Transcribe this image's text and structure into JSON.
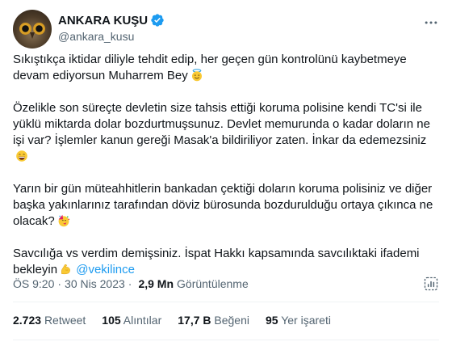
{
  "author": {
    "display_name": "ANKARA KUŞU",
    "handle": "@ankara_kusu",
    "verified": true,
    "avatar": "owl-avatar"
  },
  "tweet": {
    "p1_text": "Sıkıştıkça iktidar diliyle tehdit edip, her geçen gün kontrolünü kaybetmeye devam ediyorsun Muharrem Bey",
    "p1_emoji": "smiling-face-with-halo",
    "p2_text": "Özelikle son süreçte devletin size tahsis ettiği koruma polisine kendi TC'si ile yüklü miktarda dolar bozdurtmuşsunuz. Devlet memurunda o kadar doların ne işi var? İşlemler kanun gereği Masak'a bildiriliyor zaten. İnkar da edemezsiniz",
    "p2_emoji": "grinning-face-with-smiling-eyes",
    "p3_text": "Yarın bir gün müteahhitlerin bankadan çektiği doların koruma polisiniz ve diğer başka yakınlarınız tarafından döviz bürosunda bozdurulduğu ortaya çıkınca ne olacak?",
    "p3_emoji": "partying-face",
    "p4_text": "Savcılığa vs verdim demişsiniz. İspat Hakkı kapsamında savcılıktaki ifademi bekleyin",
    "p4_emoji": "flexed-biceps",
    "mention": "@vekilince"
  },
  "meta": {
    "time": "ÖS 9:20",
    "date": "30 Nis 2023",
    "views": "2,9 Mn",
    "views_label": "Görüntülenme"
  },
  "stats": [
    {
      "value": "2.723",
      "label": "Retweet"
    },
    {
      "value": "105",
      "label": "Alıntılar"
    },
    {
      "value": "17,7 B",
      "label": "Beğeni"
    },
    {
      "value": "95",
      "label": "Yer işareti"
    }
  ],
  "colors": {
    "accent": "#1d9bf0",
    "text": "#0f1419",
    "secondary": "#536471",
    "divider": "#eff3f4"
  }
}
